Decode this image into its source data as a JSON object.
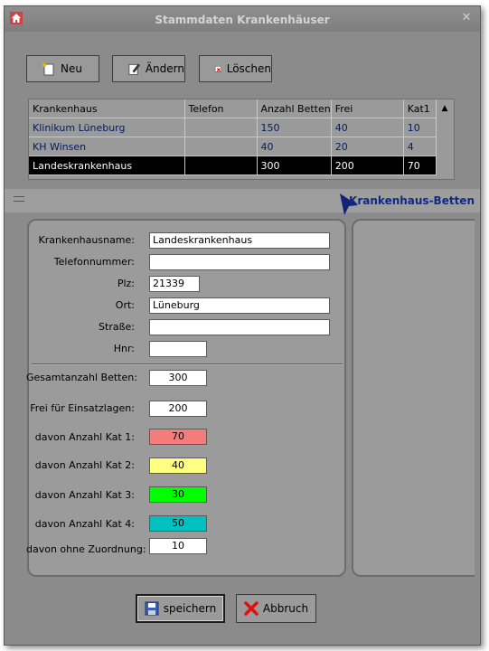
{
  "window": {
    "title": "Stammdaten Krankenhäuser",
    "app_icon": "house-icon",
    "close_label": "✕"
  },
  "toolbar": {
    "new_label": "Neu",
    "edit_label": "Ändern",
    "delete_label": "Löschen"
  },
  "grid": {
    "columns": [
      "Krankenhaus",
      "Telefon",
      "Anzahl Betten",
      "Frei",
      "Kat1"
    ],
    "rows": [
      {
        "name": "Klinikum Lüneburg",
        "phone": "",
        "beds": "150",
        "free": "40",
        "kat1": "10"
      },
      {
        "name": "KH Winsen",
        "phone": "",
        "beds": "40",
        "free": "20",
        "kat1": "4"
      },
      {
        "name": "Landeskrankenhaus",
        "phone": "",
        "beds": "300",
        "free": "200",
        "kat1": "70"
      }
    ],
    "selected_row": 2
  },
  "panel": {
    "title": "Krankenhaus-Betten"
  },
  "form": {
    "name_label": "Krankenhausname:",
    "name_value": "Landeskrankenhaus",
    "phone_label": "Telefonnummer:",
    "phone_value": "",
    "plz_label": "Plz:",
    "plz_value": "21339",
    "ort_label": "Ort:",
    "ort_value": "Lüneburg",
    "street_label": "Straße:",
    "street_value": "",
    "hnr_label": "Hnr:",
    "hnr_value": "",
    "total_label": "Gesamtanzahl Betten:",
    "total_value": "300",
    "free_label": "Frei für Einsatzlagen:",
    "free_value": "200",
    "kat1_label": "davon Anzahl Kat 1:",
    "kat1_value": "70",
    "kat2_label": "davon Anzahl Kat 2:",
    "kat2_value": "40",
    "kat3_label": "davon Anzahl Kat 3:",
    "kat3_value": "30",
    "kat4_label": "davon Anzahl Kat 4:",
    "kat4_value": "50",
    "none_label": "davon ohne Zuordnung:",
    "none_value": "10"
  },
  "colors": {
    "kat1": "#f47c7c",
    "kat2": "#ffff80",
    "kat3": "#00ff00",
    "kat4": "#00c0c0",
    "panel_title": "#0f2a85"
  },
  "footer": {
    "save_label": "speichern",
    "cancel_label": "Abbruch"
  }
}
